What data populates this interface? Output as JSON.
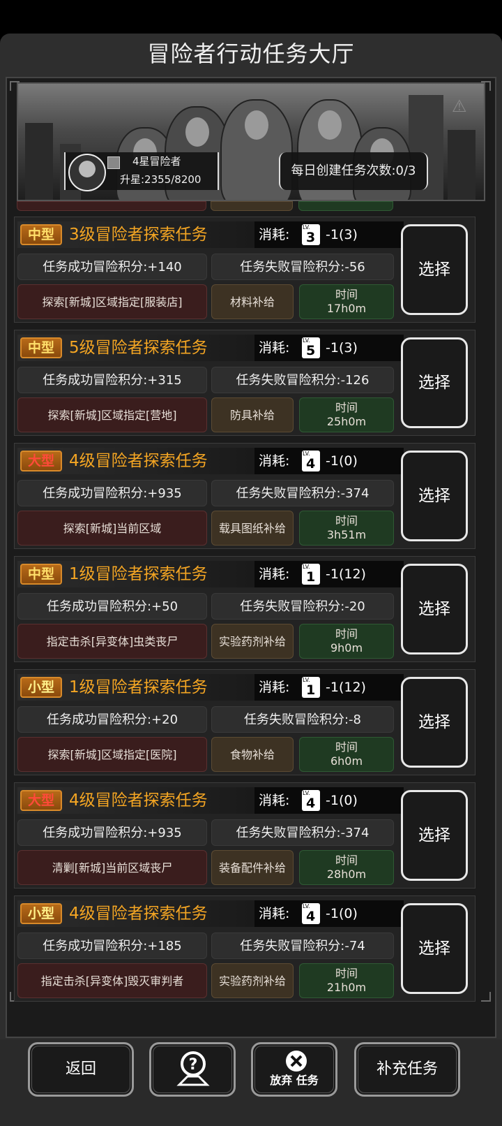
{
  "window": {
    "title": "冒险者行动任务大厅"
  },
  "profile": {
    "rank": "4星冒险者",
    "upstar": "升星:2355/8200"
  },
  "daily": {
    "label": "每日创建任务次数:0/3"
  },
  "cost_label": "消耗:",
  "select_label": "选择",
  "time_label": "时间",
  "tasks": [
    {
      "size": "中型",
      "title": "3级冒险者探索任务",
      "lv": "3",
      "cost": "-1(3)",
      "success": "任务成功冒险积分:+140",
      "fail": "任务失败冒险积分:-56",
      "target": "探索[新城]区域指定[服装店]",
      "reward": "材料补给",
      "time": "17h0m"
    },
    {
      "size": "中型",
      "title": "5级冒险者探索任务",
      "lv": "5",
      "cost": "-1(3)",
      "success": "任务成功冒险积分:+315",
      "fail": "任务失败冒险积分:-126",
      "target": "探索[新城]区域指定[营地]",
      "reward": "防具补给",
      "time": "25h0m"
    },
    {
      "size": "大型",
      "title": "4级冒险者探索任务",
      "lv": "4",
      "cost": "-1(0)",
      "success": "任务成功冒险积分:+935",
      "fail": "任务失败冒险积分:-374",
      "target": "探索[新城]当前区域",
      "reward": "载具图纸补给",
      "time": "3h51m"
    },
    {
      "size": "中型",
      "title": "1级冒险者探索任务",
      "lv": "1",
      "cost": "-1(12)",
      "success": "任务成功冒险积分:+50",
      "fail": "任务失败冒险积分:-20",
      "target": "指定击杀[异变体]虫类丧尸",
      "reward": "实验药剂补给",
      "time": "9h0m"
    },
    {
      "size": "小型",
      "title": "1级冒险者探索任务",
      "lv": "1",
      "cost": "-1(12)",
      "success": "任务成功冒险积分:+20",
      "fail": "任务失败冒险积分:-8",
      "target": "探索[新城]区域指定[医院]",
      "reward": "食物补给",
      "time": "6h0m"
    },
    {
      "size": "大型",
      "title": "4级冒险者探索任务",
      "lv": "4",
      "cost": "-1(0)",
      "success": "任务成功冒险积分:+935",
      "fail": "任务失败冒险积分:-374",
      "target": "清剿[新城]当前区域丧尸",
      "reward": "装备配件补给",
      "time": "28h0m"
    },
    {
      "size": "小型",
      "title": "4级冒险者探索任务",
      "lv": "4",
      "cost": "-1(0)",
      "success": "任务成功冒险积分:+185",
      "fail": "任务失败冒险积分:-74",
      "target": "指定击杀[异变体]毁灭审判者",
      "reward": "实验药剂补给",
      "time": "21h0m"
    }
  ],
  "footer": {
    "back": "返回",
    "abandon": "放弃 任务",
    "supplement": "补充任务",
    "help_icon": "help-map-icon",
    "abandon_icon": "close-circle-icon"
  },
  "colors": {
    "accent": "#f5a623",
    "task_red": "#3a1d1d",
    "task_brown": "#3d3223",
    "task_green": "#1f3a22"
  }
}
